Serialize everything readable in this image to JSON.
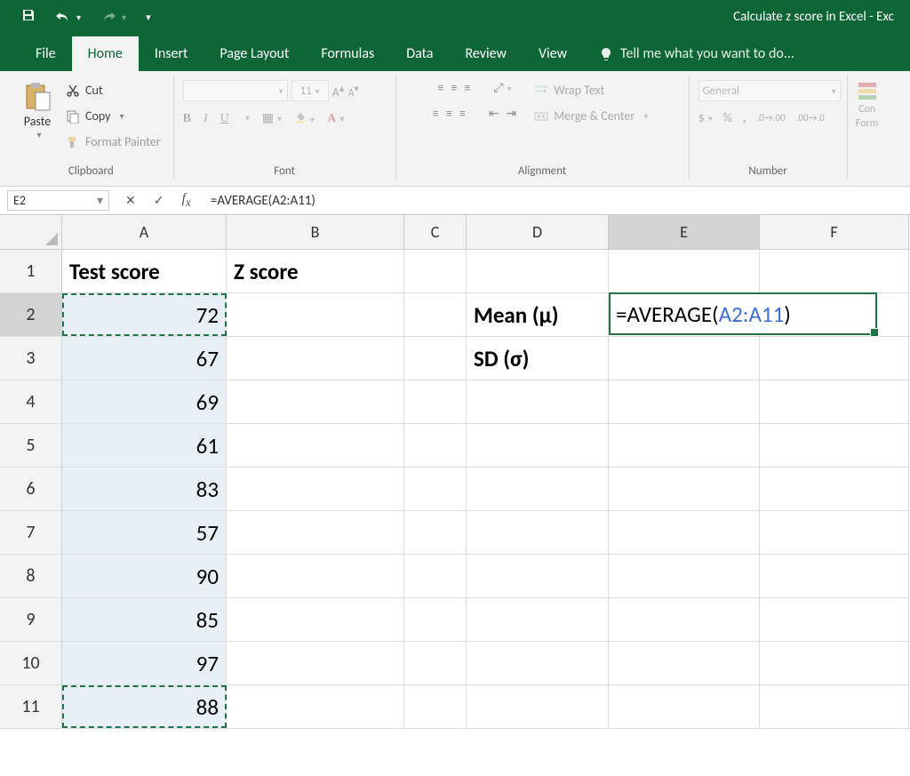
{
  "title": "Calculate z score in Excel - Exc",
  "tabs": {
    "file": "File",
    "home": "Home",
    "insert": "Insert",
    "pagelayout": "Page Layout",
    "formulas": "Formulas",
    "data": "Data",
    "review": "Review",
    "view": "View"
  },
  "tellme": "Tell me what you want to do...",
  "ribbon": {
    "paste": "Paste",
    "cut": "Cut",
    "copy": "Copy",
    "fmtpainter": "Format Painter",
    "clipboard": "Clipboard",
    "fontsize": "11",
    "fontgroup": "Font",
    "wraptext": "Wrap Text",
    "merge": "Merge & Center",
    "alignment": "Alignment",
    "general": "General",
    "number": "Number",
    "condfmt": "Con",
    "condfmt2": "Form"
  },
  "namebox": "E2",
  "formula": "=AVERAGE(A2:A11)",
  "columns": [
    "A",
    "B",
    "C",
    "D",
    "E",
    "F"
  ],
  "rows": [
    "1",
    "2",
    "3",
    "4",
    "5",
    "6",
    "7",
    "8",
    "9",
    "10",
    "11"
  ],
  "headers": {
    "A1": "Test score",
    "B1": "Z score"
  },
  "colA": {
    "r2": "72",
    "r3": "67",
    "r4": "69",
    "r5": "61",
    "r6": "83",
    "r7": "57",
    "r8": "90",
    "r9": "85",
    "r10": "97",
    "r11": "88"
  },
  "colD": {
    "r2": "Mean (µ)",
    "r3": "SD (σ)"
  },
  "edit": {
    "prefix": "=AVERAGE(",
    "ref": "A2:A11",
    "suffix": ")"
  }
}
